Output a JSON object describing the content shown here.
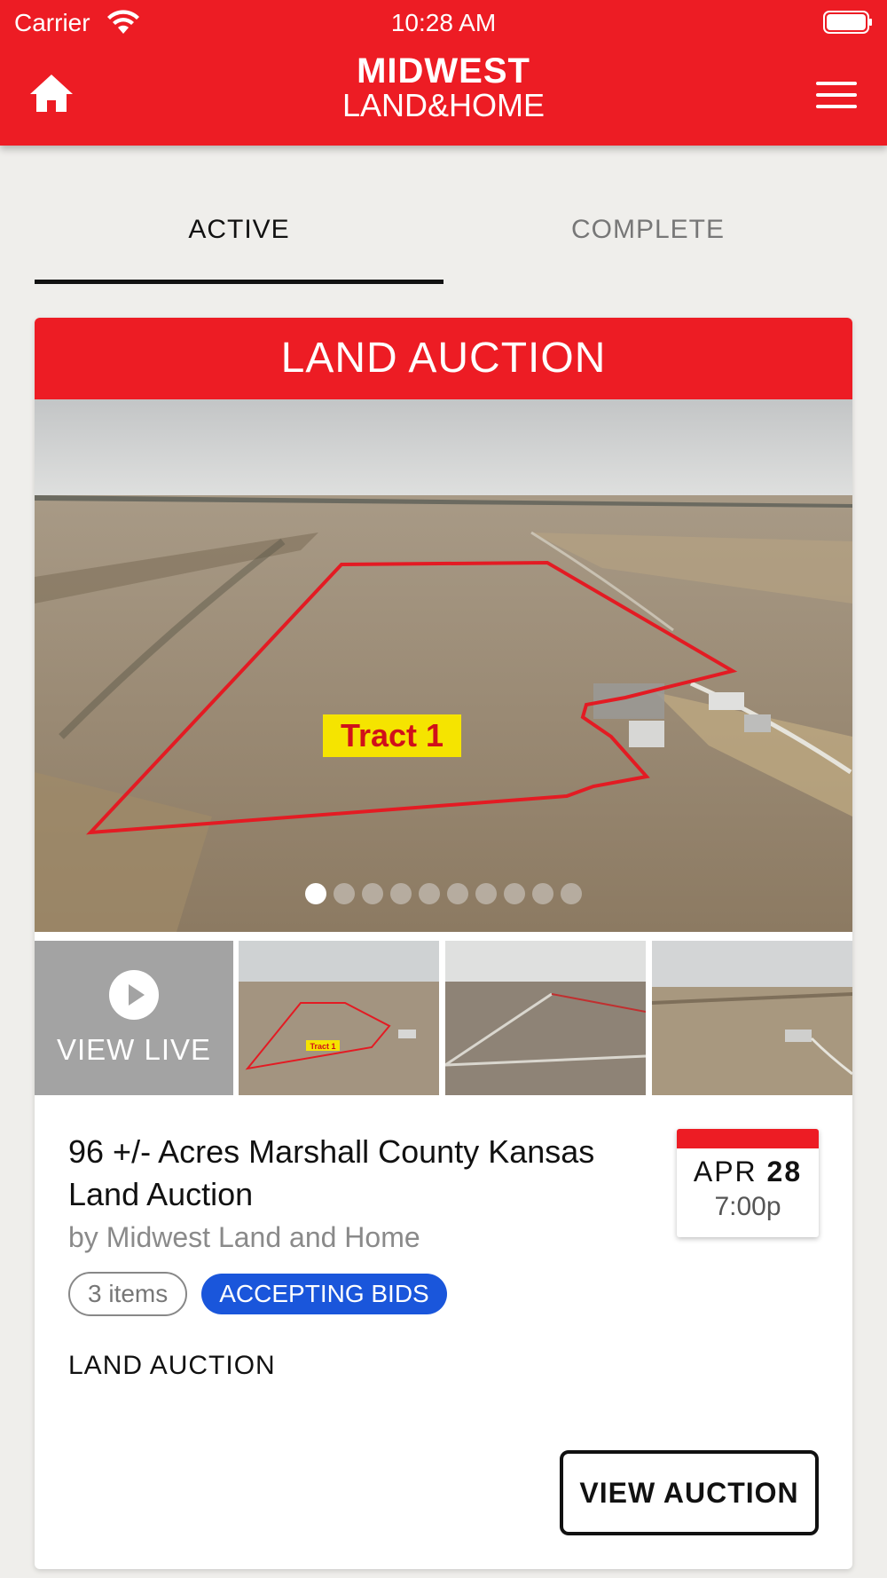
{
  "status_bar": {
    "carrier": "Carrier",
    "time": "10:28 AM"
  },
  "header": {
    "logo_line1": "MIDWEST",
    "logo_line2": "LAND&HOME",
    "home_icon": "home-icon",
    "menu_icon": "hamburger-menu-icon",
    "brand_color": "#ed1c24"
  },
  "tabs": [
    {
      "label": "ACTIVE",
      "selected": true
    },
    {
      "label": "COMPLETE",
      "selected": false
    }
  ],
  "auction": {
    "header": "LAND AUCTION",
    "hero_overlay": "Tract 1",
    "carousel_total": 10,
    "carousel_index": 1,
    "view_live_label": "VIEW LIVE",
    "thumbnail_overlay": "Tract 1",
    "title": "96 +/- Acres Marshall County Kansas Land Auction",
    "byline": "by Midwest Land and Home",
    "items_badge": "3 items",
    "status_badge": "ACCEPTING BIDS",
    "status_color": "#1a56db",
    "category": "LAND AUCTION",
    "date_month": "APR",
    "date_day": "28",
    "date_time": "7:00p",
    "button_label": "VIEW AUCTION"
  }
}
